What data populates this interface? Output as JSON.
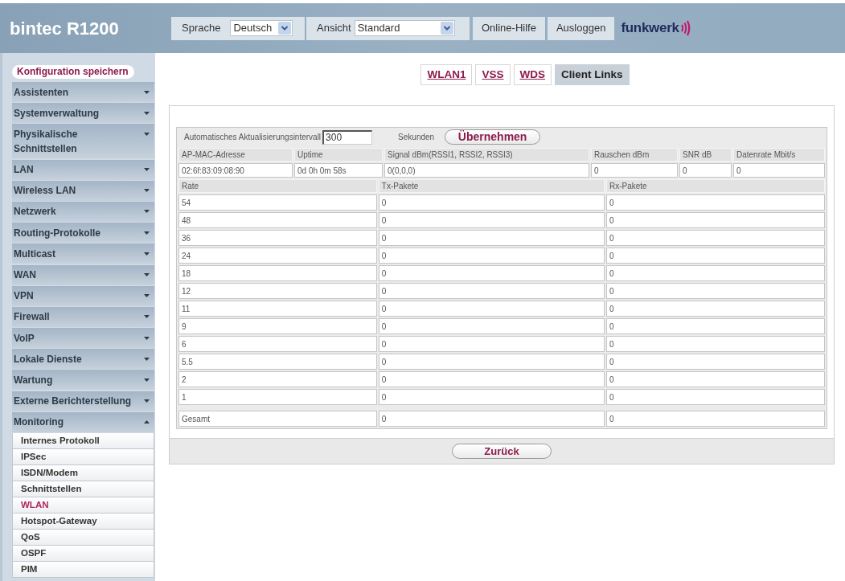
{
  "header": {
    "product": "bintec R1200",
    "language": {
      "label": "Sprache",
      "value": "Deutsch"
    },
    "view": {
      "label": "Ansicht",
      "value": "Standard"
    },
    "buttons": [
      "Online-Hilfe",
      "Ausloggen"
    ],
    "logo": "funkwerk"
  },
  "sidebar": {
    "save_button": "Konfiguration speichern",
    "items": [
      {
        "label": "Assistenten",
        "expanded": false
      },
      {
        "label": "Systemverwaltung",
        "expanded": false
      },
      {
        "label": "Physikalische Schnittstellen",
        "expanded": false
      },
      {
        "label": "LAN",
        "expanded": false
      },
      {
        "label": "Wireless LAN",
        "expanded": false
      },
      {
        "label": "Netzwerk",
        "expanded": false
      },
      {
        "label": "Routing-Protokolle",
        "expanded": false
      },
      {
        "label": "Multicast",
        "expanded": false
      },
      {
        "label": "WAN",
        "expanded": false
      },
      {
        "label": "VPN",
        "expanded": false
      },
      {
        "label": "Firewall",
        "expanded": false
      },
      {
        "label": "VoIP",
        "expanded": false
      },
      {
        "label": "Lokale Dienste",
        "expanded": false
      },
      {
        "label": "Wartung",
        "expanded": false
      },
      {
        "label": "Externe Berichterstellung",
        "expanded": false
      },
      {
        "label": "Monitoring",
        "expanded": true,
        "children": [
          {
            "label": "Internes Protokoll",
            "selected": false
          },
          {
            "label": "IPSec",
            "selected": false
          },
          {
            "label": "ISDN/Modem",
            "selected": false
          },
          {
            "label": "Schnittstellen",
            "selected": false
          },
          {
            "label": "WLAN",
            "selected": true
          },
          {
            "label": "Hotspot-Gateway",
            "selected": false
          },
          {
            "label": "QoS",
            "selected": false
          },
          {
            "label": "OSPF",
            "selected": false
          },
          {
            "label": "PIM",
            "selected": false
          }
        ]
      }
    ]
  },
  "tabs": [
    {
      "label": "WLAN1",
      "selected": false
    },
    {
      "label": "VSS",
      "selected": false
    },
    {
      "label": "WDS",
      "selected": false
    },
    {
      "label": "Client Links",
      "selected": true
    }
  ],
  "refresh": {
    "label": "Automatisches Aktualisierungsintervall",
    "value": "300",
    "unit": "Sekunden",
    "button": "Übernehmen"
  },
  "link_table": {
    "columns": [
      "AP-MAC-Adresse",
      "Uptime",
      "Signal dBm(RSSI1, RSSI2, RSSI3)",
      "Rauschen dBm",
      "SNR dB",
      "Datenrate Mbit/s"
    ],
    "rows": [
      [
        "02:6f:83:09:08:90",
        "0d 0h 0m 58s",
        "0(0,0,0)",
        "0",
        "0",
        "0"
      ]
    ]
  },
  "rate_table": {
    "columns": [
      "Rate",
      "Tx-Pakete",
      "Rx-Pakete"
    ],
    "rows": [
      [
        "54",
        "0",
        "0"
      ],
      [
        "48",
        "0",
        "0"
      ],
      [
        "36",
        "0",
        "0"
      ],
      [
        "24",
        "0",
        "0"
      ],
      [
        "18",
        "0",
        "0"
      ],
      [
        "12",
        "0",
        "0"
      ],
      [
        "11",
        "0",
        "0"
      ],
      [
        "9",
        "0",
        "0"
      ],
      [
        "6",
        "0",
        "0"
      ],
      [
        "5.5",
        "0",
        "0"
      ],
      [
        "2",
        "0",
        "0"
      ],
      [
        "1",
        "0",
        "0"
      ]
    ],
    "total": [
      "Gesamt",
      "0",
      "0"
    ]
  },
  "back_button": "Zurück"
}
